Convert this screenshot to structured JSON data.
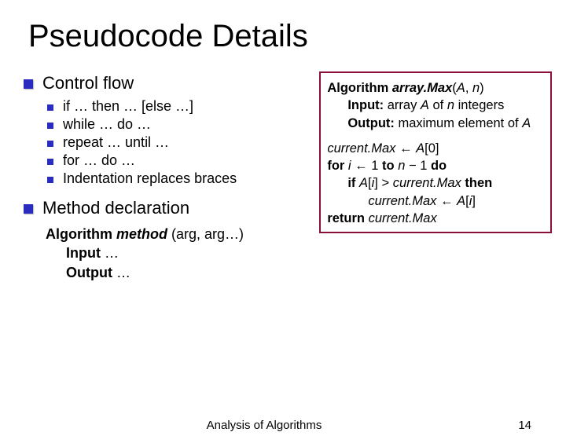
{
  "title": "Pseudocode Details",
  "sections": {
    "control_flow": {
      "heading": "Control flow",
      "items": [
        "if … then … [else …]",
        "while … do …",
        "repeat … until …",
        "for … do …",
        "Indentation replaces braces"
      ]
    },
    "method_decl": {
      "heading": "Method declaration",
      "lines": {
        "l1_algo": "Algorithm",
        "l1_method": "method",
        "l1_args": "(arg, arg…)",
        "l2_label": "Input",
        "l2_rest": " …",
        "l3_label": "Output",
        "l3_rest": " …"
      }
    }
  },
  "algorithm_box": {
    "sig_kw": "Algorithm",
    "sig_name": "array.Max",
    "sig_open": "(",
    "sig_a": "A",
    "sig_comma": ", ",
    "sig_n": "n",
    "sig_close": ")",
    "input_label": "Input:",
    "input_text1": " array ",
    "input_A": "A",
    "input_text2": " of ",
    "input_n": "n",
    "input_text3": " integers",
    "output_label": "Output:",
    "output_text1": " maximum element of ",
    "output_A": "A",
    "body": {
      "l1_lhs": "current.Max",
      "l1_arrow": " ← ",
      "l1_rhs_A": "A",
      "l1_rhs_idx": "[0]",
      "l2_for": "for ",
      "l2_i": "i",
      "l2_arrow": " ← ",
      "l2_one": "1",
      "l2_to": " to ",
      "l2_n": "n",
      "l2_minus": " − ",
      "l2_one2": "1",
      "l2_do": " do",
      "l3_if": "if ",
      "l3_A": "A",
      "l3_idx_open": "[",
      "l3_i": "i",
      "l3_idx_close": "]",
      "l3_gt": " > ",
      "l3_cm": "current.Max",
      "l3_then": " then",
      "l4_cm": "current.Max",
      "l4_arrow": " ← ",
      "l4_A": "A",
      "l4_idx_open": "[",
      "l4_i": "i",
      "l4_idx_close": "]",
      "l5_return": "return ",
      "l5_cm": "current.Max"
    }
  },
  "footer": {
    "text": "Analysis of Algorithms",
    "page": "14"
  }
}
